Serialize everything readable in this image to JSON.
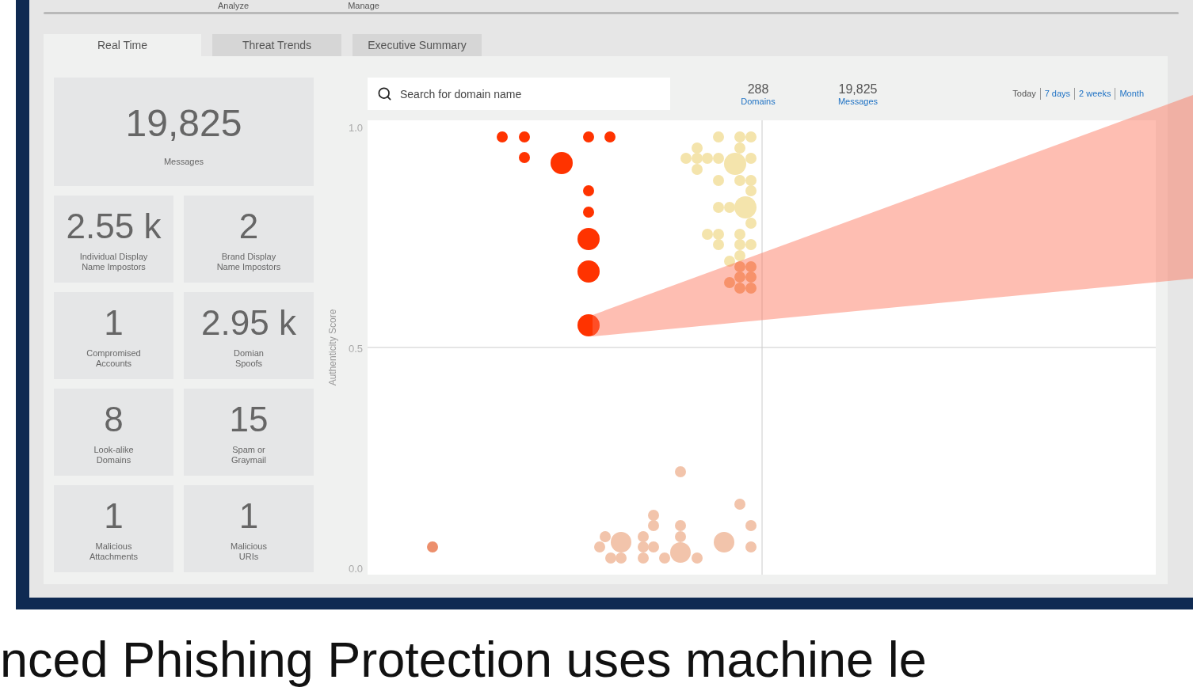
{
  "nav": [
    {
      "label": "Analyze"
    },
    {
      "label": "Manage"
    }
  ],
  "tabs": [
    {
      "label": "Real Time",
      "selected": true
    },
    {
      "label": "Threat Trends",
      "selected": false
    },
    {
      "label": "Executive Summary",
      "selected": false
    }
  ],
  "tiles": [
    {
      "kind": "wide",
      "value": "19,825",
      "label": "Messages"
    },
    {
      "kind": "small",
      "value": "2.55 k",
      "label": "Individual Display\nName Impostors"
    },
    {
      "kind": "small",
      "value": "2",
      "label": "Brand Display\nName Impostors"
    },
    {
      "kind": "small",
      "value": "1",
      "label": "Compromised\nAccounts"
    },
    {
      "kind": "small",
      "value": "2.95 k",
      "label": "Domian\nSpoofs"
    },
    {
      "kind": "small",
      "value": "8",
      "label": "Look-alike\nDomains"
    },
    {
      "kind": "small",
      "value": "15",
      "label": "Spam or\nGraymail"
    },
    {
      "kind": "small",
      "value": "1",
      "label": "Malicious\nAttachments"
    },
    {
      "kind": "small",
      "value": "1",
      "label": "Malicious\nURIs"
    }
  ],
  "search": {
    "placeholder": "Search for domain name"
  },
  "stats": [
    {
      "value": "288",
      "label": "Domains"
    },
    {
      "value": "19,825",
      "label": "Messages"
    }
  ],
  "ranges": [
    {
      "label": "Today",
      "selected": true
    },
    {
      "label": "7 days",
      "selected": false
    },
    {
      "label": "2 weeks",
      "selected": false
    },
    {
      "label": "Month",
      "selected": false
    }
  ],
  "chart": {
    "ylabel": "Authenticity Score",
    "yticks": [
      "1.0",
      "0.5",
      "0.0"
    ]
  },
  "caption": "nced Phishing Protection uses machine le"
}
